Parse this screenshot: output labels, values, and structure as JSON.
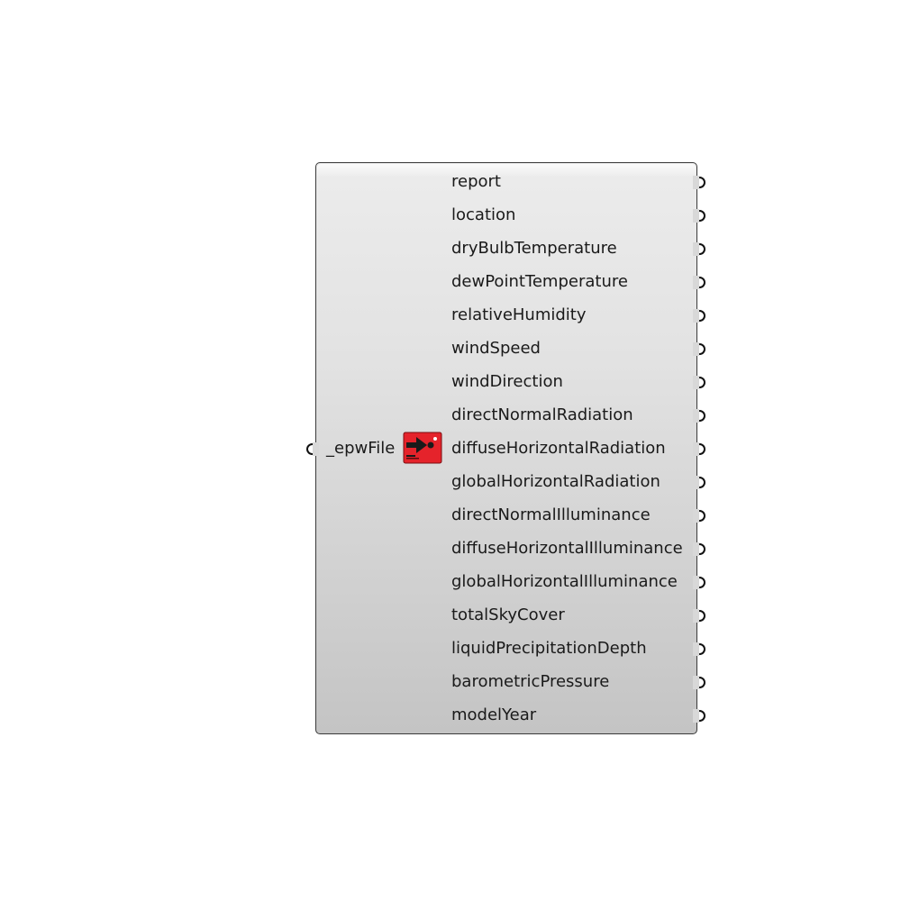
{
  "component": {
    "input": {
      "label": "_epwFile"
    },
    "icon": "ladybug-import-epw-icon",
    "outputs": [
      "report",
      "location",
      "dryBulbTemperature",
      "dewPointTemperature",
      "relativeHumidity",
      "windSpeed",
      "windDirection",
      "directNormalRadiation",
      "diffuseHorizontalRadiation",
      "globalHorizontalRadiation",
      "directNormalIlluminance",
      "diffuseHorizontalIlluminance",
      "globalHorizontalIlluminance",
      "totalSkyCover",
      "liquidPrecipitationDepth",
      "barometricPressure",
      "modelYear"
    ]
  },
  "colors": {
    "icon_red": "#e5232b",
    "icon_dark": "#1a1a1a",
    "border": "#3a3a3a"
  }
}
